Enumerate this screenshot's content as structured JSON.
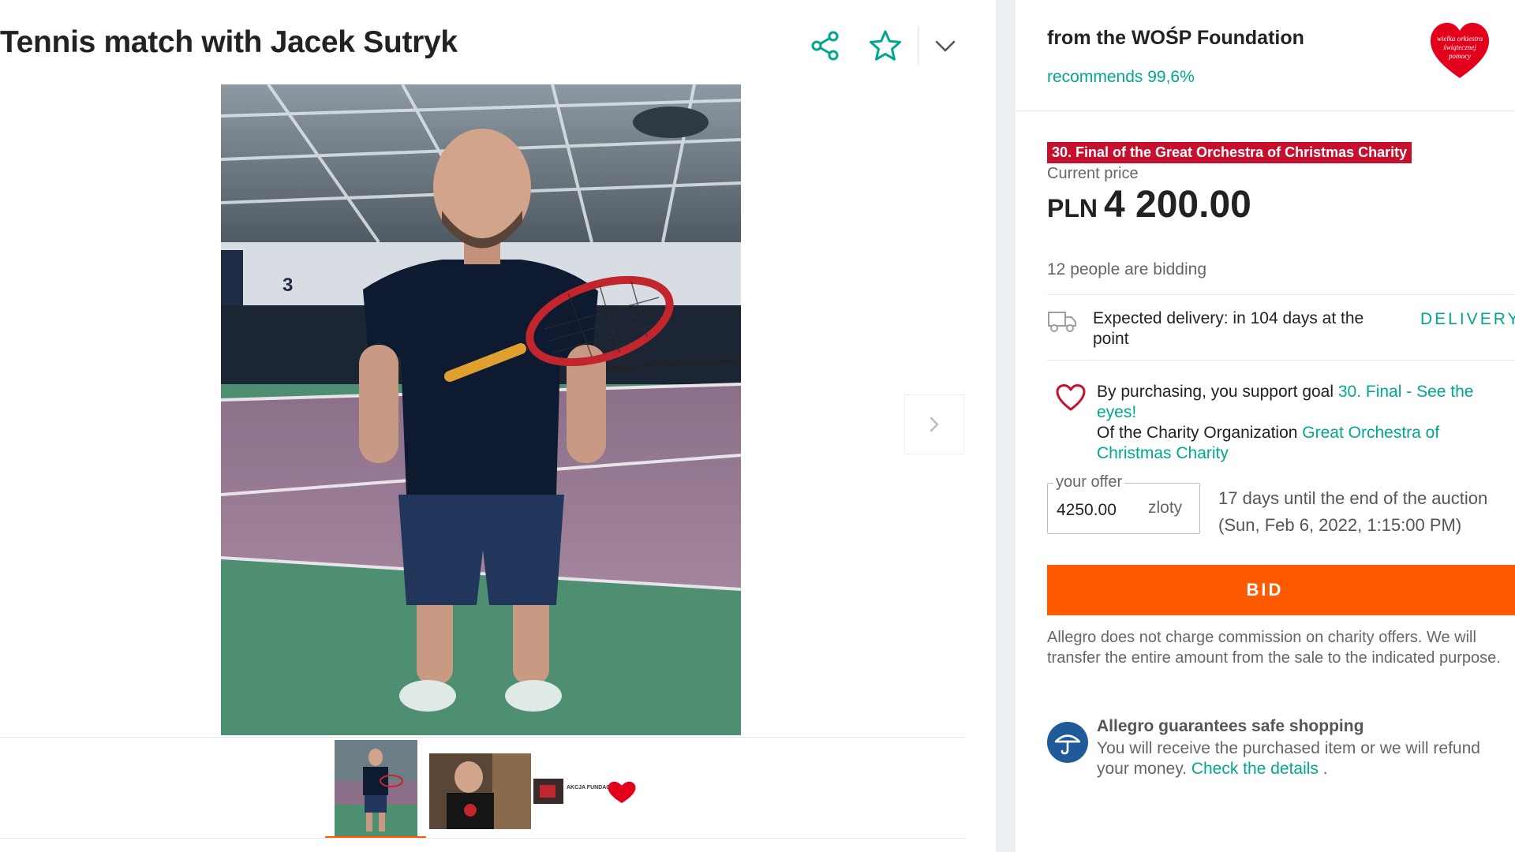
{
  "listing": {
    "title": "Tennis match with Jacek Sutryk",
    "header_icons": [
      "share-icon",
      "star-icon",
      "chevron-down-icon"
    ],
    "thumbnail_banner_text": "AKCJA FUNDACJA WOŚP"
  },
  "seller": {
    "name": "from the WOŚP Foundation",
    "recommends": "recommends 99,6%",
    "logo_text": [
      "wielka orkiestra",
      "świątecznej",
      "pomocy"
    ]
  },
  "offer": {
    "campaign_badge": "30. Final of the Great Orchestra of Christmas Charity",
    "price_label": "Current price",
    "currency": "PLN",
    "price": "4 200.00",
    "bidders": "12 people are bidding",
    "delivery_text": "Expected delivery: in 104 days at the point",
    "delivery_link": "DELIVERY",
    "support_text": "By purchasing, you support goal ",
    "support_goal_link": "30. Final - See the eyes!",
    "organization_text": "Of the Charity Organization ",
    "organization_link": "Great Orchestra of Christmas Charity",
    "your_offer_label": "your offer",
    "your_offer_value": "4250.00",
    "your_offer_unit": "zloty",
    "auction_end": "17 days until the end of the auction (Sun, Feb 6, 2022, 1:15:00 PM)",
    "bid_button": "BID",
    "commission_note": "Allegro does not charge commission on charity offers. We will transfer the entire amount from the sale to the indicated purpose."
  },
  "guarantee": {
    "title": "Allegro guarantees safe shopping",
    "text": "You will receive the purchased item or we will refund your money. ",
    "link": "Check the details",
    "suffix": " ."
  },
  "colors": {
    "accent": "#00a790",
    "bid_button": "#ff5a00",
    "campaign_badge": "#c8102e",
    "guarantee_icon": "#1f5b9a"
  }
}
